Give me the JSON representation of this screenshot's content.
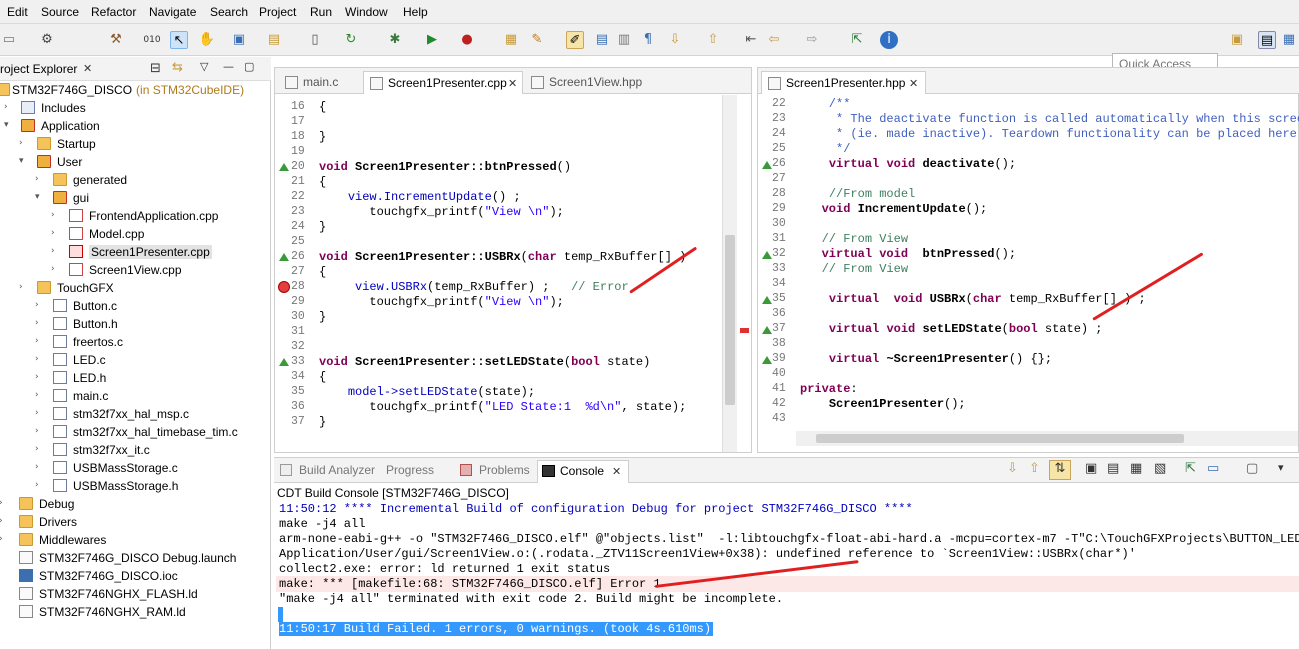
{
  "menu": [
    "Edit",
    "Source",
    "Refactor",
    "Navigate",
    "Search",
    "Project",
    "Run",
    "Window",
    "Help"
  ],
  "toolbar": {
    "quick_access_placeholder": "Quick Access"
  },
  "explorer": {
    "title": "roject Explorer",
    "project": "STM32F746G_DISCO",
    "project_suffix": "(in STM32CubeIDE)",
    "items": [
      {
        "label": "Includes"
      },
      {
        "label": "Application"
      },
      {
        "label": "Startup"
      },
      {
        "label": "User"
      },
      {
        "label": "generated"
      },
      {
        "label": "gui"
      },
      {
        "label": "FrontendApplication.cpp"
      },
      {
        "label": "Model.cpp"
      },
      {
        "label": "Screen1Presenter.cpp"
      },
      {
        "label": "Screen1View.cpp"
      },
      {
        "label": "TouchGFX"
      },
      {
        "label": "Button.c"
      },
      {
        "label": "Button.h"
      },
      {
        "label": "freertos.c"
      },
      {
        "label": "LED.c"
      },
      {
        "label": "LED.h"
      },
      {
        "label": "main.c"
      },
      {
        "label": "stm32f7xx_hal_msp.c"
      },
      {
        "label": "stm32f7xx_hal_timebase_tim.c"
      },
      {
        "label": "stm32f7xx_it.c"
      },
      {
        "label": "USBMassStorage.c"
      },
      {
        "label": "USBMassStorage.h"
      },
      {
        "label": "Debug"
      },
      {
        "label": "Drivers"
      },
      {
        "label": "Middlewares"
      },
      {
        "label": "STM32F746G_DISCO Debug.launch"
      },
      {
        "label": "STM32F746G_DISCO.ioc"
      },
      {
        "label": "STM32F746NGHX_FLASH.ld"
      },
      {
        "label": "STM32F746NGHX_RAM.ld"
      }
    ]
  },
  "editor_left": {
    "tabs": [
      "main.c",
      "Screen1Presenter.cpp",
      "Screen1View.hpp"
    ],
    "lines": [
      {
        "n": "16",
        "t": "{"
      },
      {
        "n": "17",
        "t": ""
      },
      {
        "n": "18",
        "t": "}"
      },
      {
        "n": "19",
        "t": ""
      },
      {
        "n": "20",
        "t": "void Screen1Presenter::btnPressed()"
      },
      {
        "n": "21",
        "t": "{"
      },
      {
        "n": "22",
        "t": "    view.IncrementUpdate() ;"
      },
      {
        "n": "23",
        "t": "       touchgfx_printf(\"View \\n\");"
      },
      {
        "n": "24",
        "t": "}"
      },
      {
        "n": "25",
        "t": ""
      },
      {
        "n": "26",
        "t": "void Screen1Presenter::USBRx(char temp_RxBuffer[] )"
      },
      {
        "n": "27",
        "t": "{"
      },
      {
        "n": "28",
        "t": "     view.USBRx(temp_RxBuffer) ;   // Error"
      },
      {
        "n": "29",
        "t": "       touchgfx_printf(\"View \\n\");"
      },
      {
        "n": "30",
        "t": "}"
      },
      {
        "n": "31",
        "t": ""
      },
      {
        "n": "32",
        "t": ""
      },
      {
        "n": "33",
        "t": "void Screen1Presenter::setLEDState(bool state)"
      },
      {
        "n": "34",
        "t": "{"
      },
      {
        "n": "35",
        "t": "    model->setLEDState(state);"
      },
      {
        "n": "36",
        "t": "       touchgfx_printf(\"LED State:1  %d\\n\", state);"
      },
      {
        "n": "37",
        "t": "}"
      }
    ]
  },
  "editor_right": {
    "tabs": [
      "Screen1Presenter.hpp"
    ],
    "lines": [
      {
        "n": "22",
        "t": "    /**"
      },
      {
        "n": "23",
        "t": "     * The deactivate function is called automatically when this screen"
      },
      {
        "n": "24",
        "t": "     * (ie. made inactive). Teardown functionality can be placed here."
      },
      {
        "n": "25",
        "t": "     */"
      },
      {
        "n": "26",
        "t": "    virtual void deactivate();"
      },
      {
        "n": "27",
        "t": ""
      },
      {
        "n": "28",
        "t": "    //From model"
      },
      {
        "n": "29",
        "t": "   void IncrementUpdate();"
      },
      {
        "n": "30",
        "t": ""
      },
      {
        "n": "31",
        "t": "   // From View"
      },
      {
        "n": "32",
        "t": "   virtual void  btnPressed();"
      },
      {
        "n": "33",
        "t": "   // From View"
      },
      {
        "n": "34",
        "t": ""
      },
      {
        "n": "35",
        "t": "    virtual  void USBRx(char temp_RxBuffer[] ) ;"
      },
      {
        "n": "36",
        "t": ""
      },
      {
        "n": "37",
        "t": "    virtual void setLEDState(bool state) ;"
      },
      {
        "n": "38",
        "t": ""
      },
      {
        "n": "39",
        "t": "    virtual ~Screen1Presenter() {};"
      },
      {
        "n": "40",
        "t": ""
      },
      {
        "n": "41",
        "t": "private:"
      },
      {
        "n": "42",
        "t": "    Screen1Presenter();"
      },
      {
        "n": "43",
        "t": ""
      }
    ]
  },
  "console": {
    "tabs": [
      "Build Analyzer",
      "Progress",
      "Problems",
      "Console"
    ],
    "header": "CDT Build Console [STM32F746G_DISCO]",
    "lines": [
      "11:50:12 **** Incremental Build of configuration Debug for project STM32F746G_DISCO ****",
      "make -j4 all",
      "arm-none-eabi-g++ -o \"STM32F746G_DISCO.elf\" @\"objects.list\"  -l:libtouchgfx-float-abi-hard.a -mcpu=cortex-m7 -T\"C:\\TouchGFXProjects\\BUTTON_LED\\STM",
      "Application/User/gui/Screen1View.o:(.rodata._ZTV11Screen1View+0x38): undefined reference to `Screen1View::USBRx(char*)'",
      "collect2.exe: error: ld returned 1 exit status",
      "make: *** [makefile:68: STM32F746G_DISCO.elf] Error 1",
      "\"make -j4 all\" terminated with exit code 2. Build might be incomplete.",
      "",
      "11:50:17 Build Failed. 1 errors, 0 warnings. (took 4s.610ms)"
    ]
  },
  "colors": {
    "error_line_bg": "#fde8e8",
    "selection_bg": "#3399ff",
    "annotation_red": "#e02020"
  }
}
